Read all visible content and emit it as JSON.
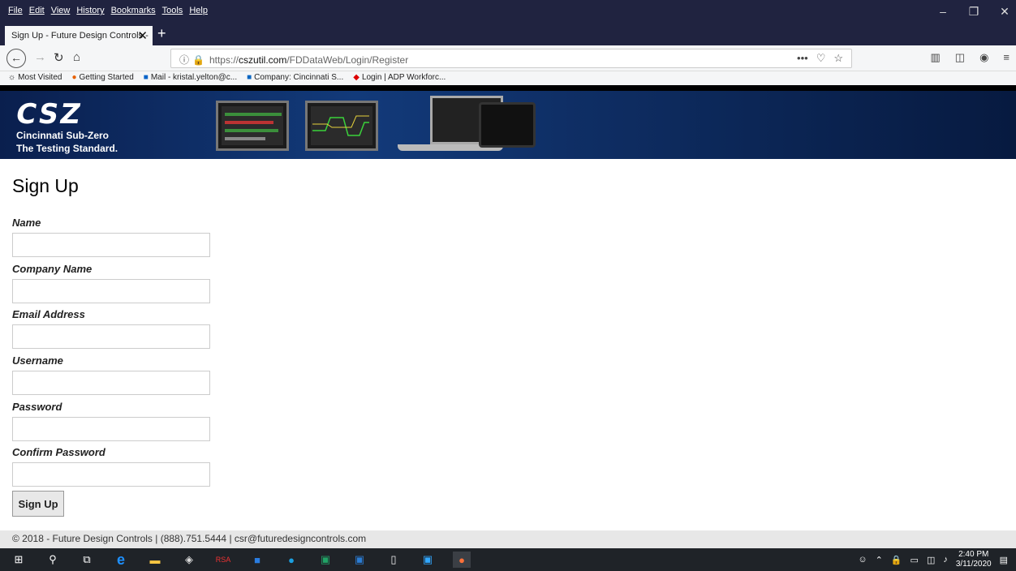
{
  "browser": {
    "menu": [
      "File",
      "Edit",
      "View",
      "History",
      "Bookmarks",
      "Tools",
      "Help"
    ],
    "tab_title": "Sign Up - Future Design Controls - ",
    "url_prefix": "https://",
    "url_domain": "cszutil.com",
    "url_path": "/FDDataWeb/Login/Register",
    "bookmarks": [
      "Most Visited",
      "Getting Started",
      "Mail - kristal.yelton@c...",
      "Company: Cincinnati S...",
      "Login | ADP Workforc..."
    ]
  },
  "banner": {
    "logo_mark": "CSZ",
    "company": "Cincinnati Sub-Zero",
    "tagline": "The Testing Standard."
  },
  "page": {
    "title": "Sign Up",
    "fields": [
      {
        "label": "Name",
        "value": ""
      },
      {
        "label": "Company Name",
        "value": ""
      },
      {
        "label": "Email Address",
        "value": ""
      },
      {
        "label": "Username",
        "value": ""
      },
      {
        "label": "Password",
        "value": ""
      },
      {
        "label": "Confirm Password",
        "value": ""
      }
    ],
    "submit_label": "Sign Up"
  },
  "footer": {
    "text": "© 2018 - Future Design Controls | (888).751.5444 | csr@futuredesigncontrols.com"
  },
  "taskbar": {
    "time": "2:40 PM",
    "date": "3/11/2020"
  }
}
